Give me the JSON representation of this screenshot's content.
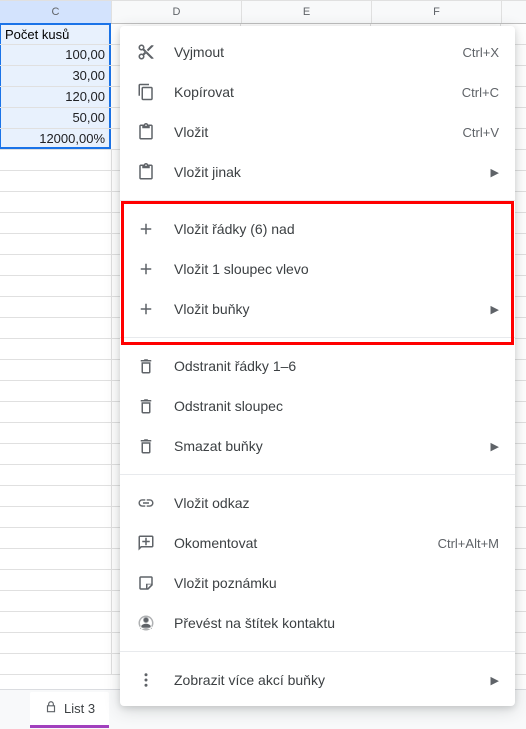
{
  "columns": {
    "c": "C",
    "d": "D",
    "e": "E",
    "f": "F"
  },
  "cells": {
    "header": "Počet kusů",
    "r2": "100,00",
    "r3": "30,00",
    "r4": "120,00",
    "r5": "50,00",
    "r6": "12000,00%"
  },
  "sheet_tab": "List 3",
  "menu": {
    "cut": {
      "label": "Vyjmout",
      "shortcut": "Ctrl+X"
    },
    "copy": {
      "label": "Kopírovat",
      "shortcut": "Ctrl+C"
    },
    "paste": {
      "label": "Vložit",
      "shortcut": "Ctrl+V"
    },
    "paste_special": {
      "label": "Vložit jinak"
    },
    "insert_rows": {
      "label": "Vložit řádky (6) nad"
    },
    "insert_col": {
      "label": "Vložit 1 sloupec vlevo"
    },
    "insert_cells": {
      "label": "Vložit buňky"
    },
    "delete_rows": {
      "label": "Odstranit řádky 1–6"
    },
    "delete_col": {
      "label": "Odstranit sloupec"
    },
    "clear_cells": {
      "label": "Smazat buňky"
    },
    "insert_link": {
      "label": "Vložit odkaz"
    },
    "comment": {
      "label": "Okomentovat",
      "shortcut": "Ctrl+Alt+M"
    },
    "insert_note": {
      "label": "Vložit poznámku"
    },
    "people_chip": {
      "label": "Převést na štítek kontaktu"
    },
    "more": {
      "label": "Zobrazit více akcí buňky"
    }
  }
}
